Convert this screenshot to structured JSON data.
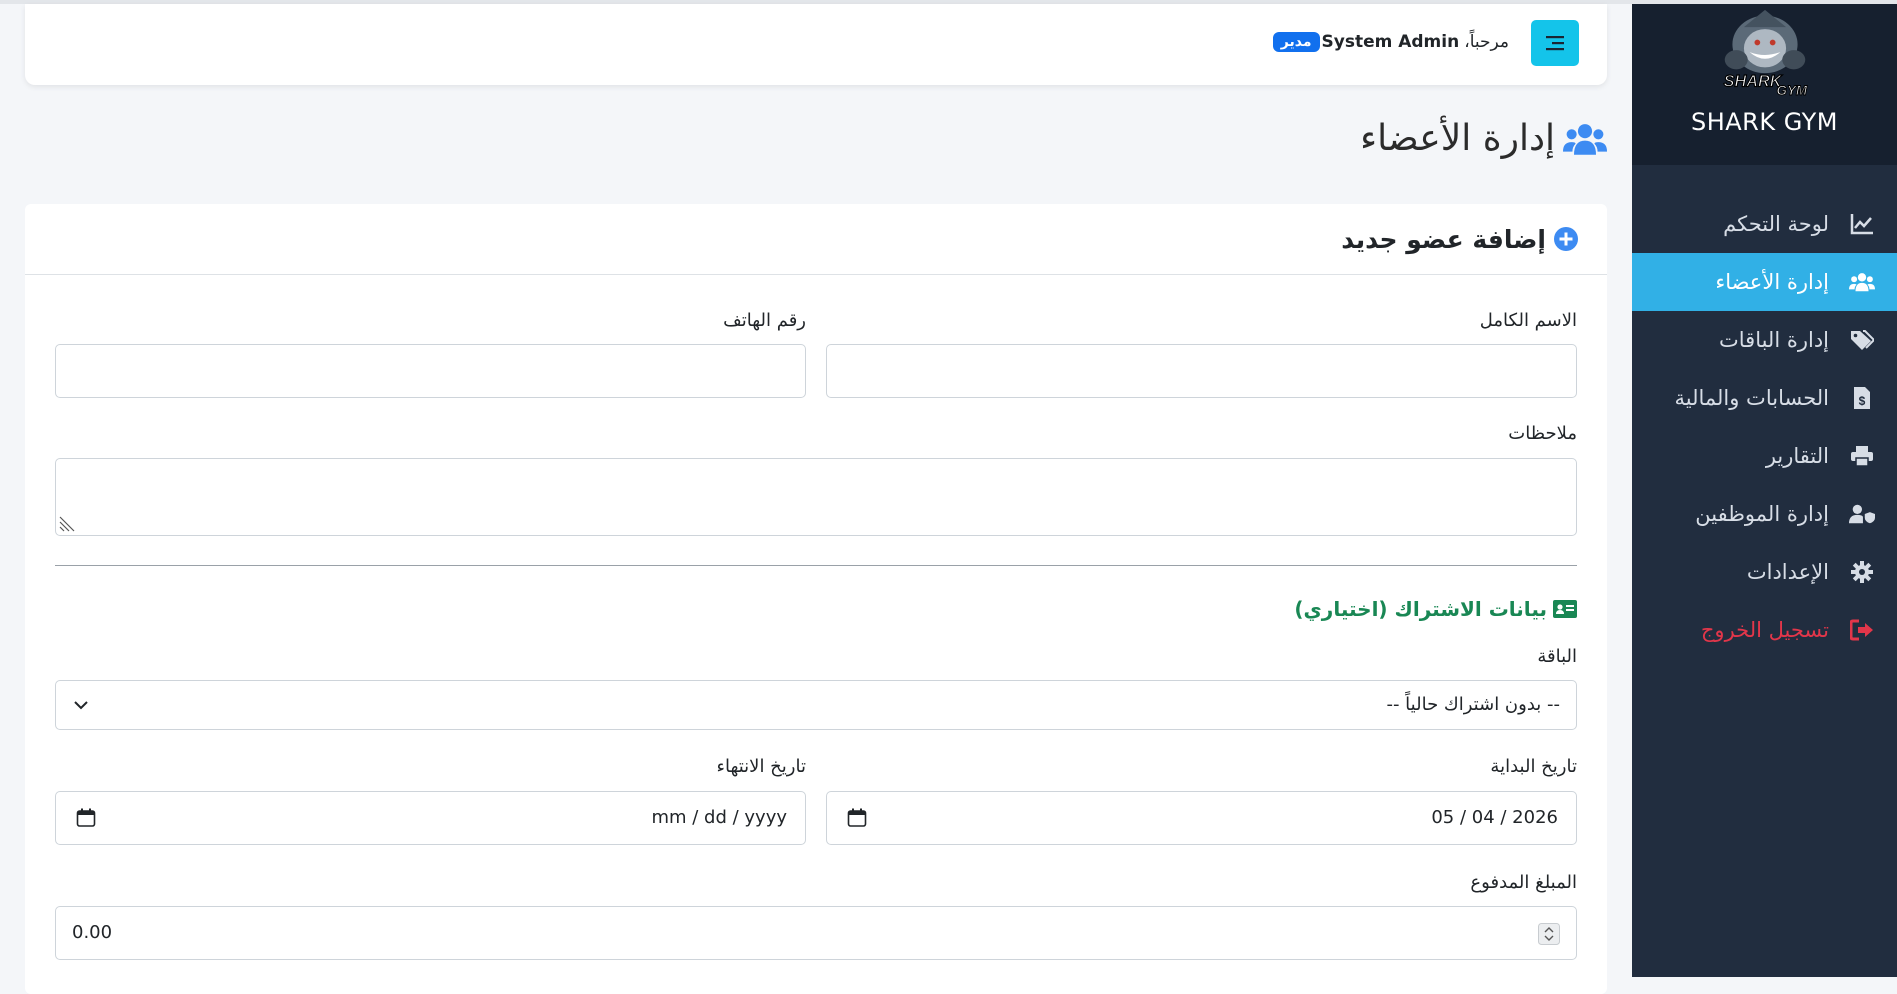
{
  "sidebar": {
    "logo_text_1": "SHARK",
    "logo_text_2": "GYM",
    "brand_name": "SHARK GYM",
    "items": [
      {
        "label": "لوحة التحكم",
        "icon": "chart-line-icon"
      },
      {
        "label": "إدارة الأعضاء",
        "icon": "users-icon",
        "active": true
      },
      {
        "label": "إدارة الباقات",
        "icon": "tags-icon"
      },
      {
        "label": "الحسابات والمالية",
        "icon": "invoice-dollar-icon"
      },
      {
        "label": "التقارير",
        "icon": "print-icon"
      },
      {
        "label": "إدارة الموظفين",
        "icon": "user-shield-icon"
      },
      {
        "label": "الإعدادات",
        "icon": "gear-icon"
      },
      {
        "label": "تسجيل الخروج",
        "icon": "sign-out-icon"
      }
    ]
  },
  "header": {
    "welcome": "مرحباً،",
    "user_name": "System Admin",
    "role_badge": "مدير"
  },
  "page": {
    "title": "إدارة الأعضاء"
  },
  "form": {
    "title": "إضافة عضو جديد",
    "full_name_label": "الاسم الكامل",
    "full_name_value": "",
    "phone_label": "رقم الهاتف",
    "phone_value": "",
    "notes_label": "ملاحظات",
    "notes_value": "",
    "subscription_title": "بيانات الاشتراك (اختياري)",
    "package_label": "الباقة",
    "package_selected": "-- بدون اشتراك حالياً --",
    "start_date_label": "تاريخ البداية",
    "start_date_value": "05 / 04 / 2026",
    "end_date_label": "تاريخ الانتهاء",
    "end_date_value": "mm / dd / yyyy",
    "amount_label": "المبلغ المدفوع",
    "amount_value": "0.00"
  },
  "colors": {
    "sidebar_bg": "#212d3f",
    "brand_bg": "#16202f",
    "active_item": "#31b0e6",
    "logout": "#e2364a",
    "toggle_button": "#14c4ea",
    "badge": "#1170ee",
    "title_icon": "#3d8bf2",
    "subscription_title": "#198754"
  }
}
